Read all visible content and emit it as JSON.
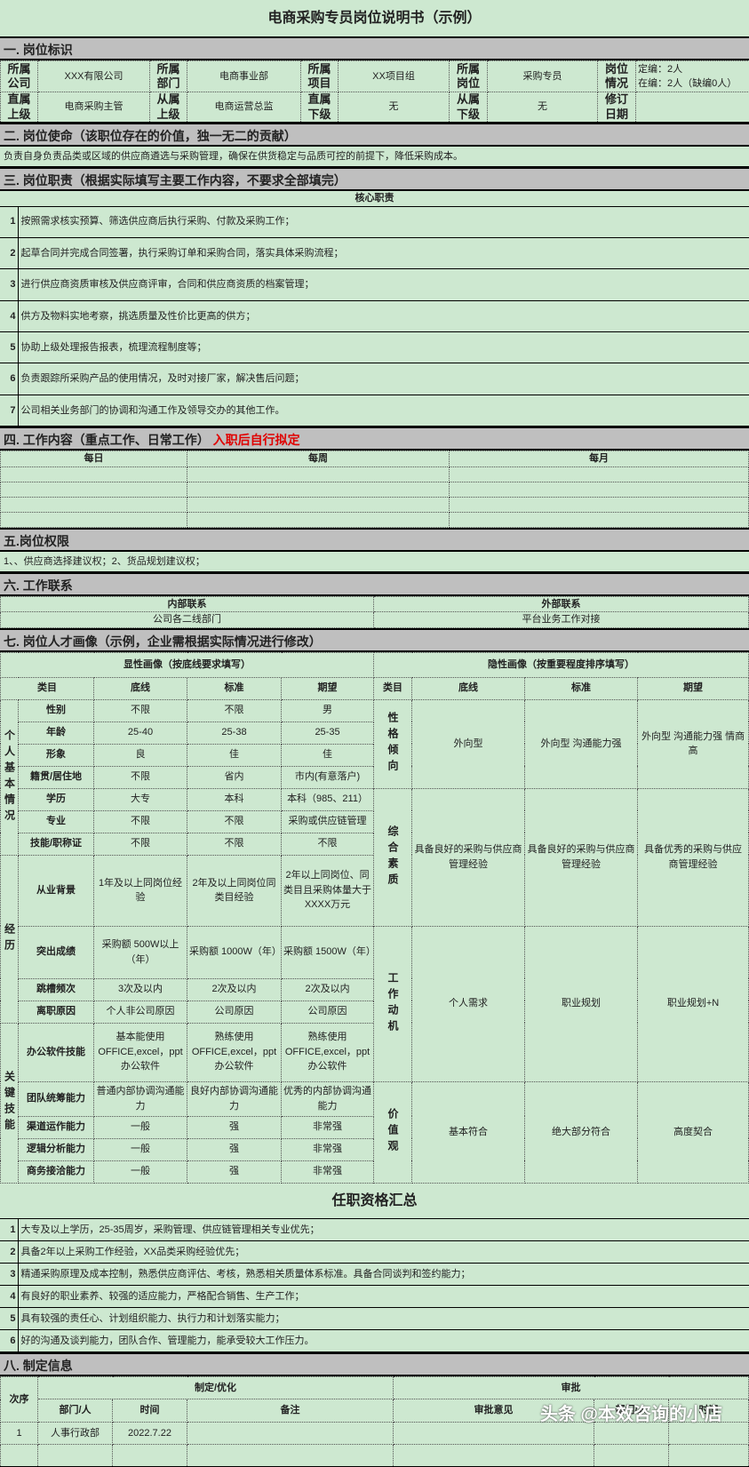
{
  "title": "电商采购专员岗位说明书（示例）",
  "s1": {
    "header": "一. 岗位标识",
    "row1": [
      {
        "label": "所属公司",
        "value": "XXX有限公司"
      },
      {
        "label": "所属部门",
        "value": "电商事业部"
      },
      {
        "label": "所属项目",
        "value": "XX项目组"
      },
      {
        "label": "所属岗位",
        "value": "采购专员"
      },
      {
        "label": "岗位情况",
        "value1": "定编：2人",
        "value2": "在编：2人（缺编0人）"
      }
    ],
    "row2": [
      {
        "label": "直属上级",
        "value": "电商采购主管"
      },
      {
        "label": "从属上级",
        "value": "电商运营总监"
      },
      {
        "label": "直属下级",
        "value": "无"
      },
      {
        "label": "从属下级",
        "value": "无"
      },
      {
        "label": "修订日期",
        "value": ""
      }
    ]
  },
  "s2": {
    "header": "二. 岗位使命（该职位存在的价值，独一无二的贡献）",
    "text": "负责自身负责品类或区域的供应商遴选与采购管理，确保在供货稳定与品质可控的前提下，降低采购成本。"
  },
  "s3": {
    "header": "三. 岗位职责（根据实际填写主要工作内容，不要求全部填完）",
    "subheader": "核心职责",
    "items": [
      {
        "n": "1",
        "t": "按照需求核实预算、筛选供应商后执行采购、付款及采购工作；"
      },
      {
        "n": "2",
        "t": "起草合同并完成合同签署，执行采购订单和采购合同，落实具体采购流程；"
      },
      {
        "n": "3",
        "t": "进行供应商资质审核及供应商评审，合同和供应商资质的档案管理；"
      },
      {
        "n": "4",
        "t": "供方及物料实地考察，挑选质量及性价比更高的供方；"
      },
      {
        "n": "5",
        "t": "协助上级处理报告报表，梳理流程制度等；"
      },
      {
        "n": "6",
        "t": "负责跟踪所采购产品的使用情况，及时对接厂家，解决售后问题；"
      },
      {
        "n": "7",
        "t": "公司相关业务部门的协调和沟通工作及领导交办的其他工作。"
      }
    ]
  },
  "s4": {
    "header": "四. 工作内容（重点工作、日常工作）",
    "note": "入职后自行拟定",
    "cols": [
      "每日",
      "每周",
      "每月"
    ]
  },
  "s5": {
    "header": "五.岗位权限",
    "text": "1、、供应商选择建议权；2、货品规划建议权；"
  },
  "s6": {
    "header": "六. 工作联系",
    "internal_label": "内部联系",
    "external_label": "外部联系",
    "internal": "公司各二线部门",
    "external": "平台业务工作对接"
  },
  "s7": {
    "header": "七. 岗位人才画像（示例，企业需根据实际情况进行修改）",
    "explicit_title": "显性画像（按底线要求填写）",
    "implicit_title": "隐性画像（按重要程度排序填写）",
    "cols": [
      "类目",
      "底线",
      "标准",
      "期望"
    ],
    "groups": [
      "个人基本情况",
      "经历",
      "关键技能"
    ],
    "rows": [
      {
        "k": "性别",
        "a": "不限",
        "b": "不限",
        "c": "男"
      },
      {
        "k": "年龄",
        "a": "25-40",
        "b": "25-38",
        "c": "25-35"
      },
      {
        "k": "形象",
        "a": "良",
        "b": "佳",
        "c": "佳"
      },
      {
        "k": "籍贯/居住地",
        "a": "不限",
        "b": "省内",
        "c": "市内(有意落户)"
      },
      {
        "k": "学历",
        "a": "大专",
        "b": "本科",
        "c": "本科（985、211）"
      },
      {
        "k": "专业",
        "a": "不限",
        "b": "不限",
        "c": "采购或供应链管理"
      },
      {
        "k": "技能/职称证",
        "a": "不限",
        "b": "不限",
        "c": "不限"
      },
      {
        "k": "从业背景",
        "a": "1年及以上同岗位经验",
        "b": "2年及以上同岗位同类目经验",
        "c": "2年以上同岗位、同类目且采购体量大于XXXX万元"
      },
      {
        "k": "突出成绩",
        "a": "采购额 500W以上（年）",
        "b": "采购额 1000W（年）",
        "c": "采购额 1500W（年）"
      },
      {
        "k": "跳槽频次",
        "a": "3次及以内",
        "b": "2次及以内",
        "c": "2次及以内"
      },
      {
        "k": "离职原因",
        "a": "个人非公司原因",
        "b": "公司原因",
        "c": "公司原因"
      },
      {
        "k": "办公软件技能",
        "a": "基本能使用OFFICE,excel，ppt办公软件",
        "b": "熟练使用OFFICE,excel，ppt办公软件",
        "c": "熟练使用OFFICE,excel，ppt办公软件"
      },
      {
        "k": "团队统筹能力",
        "a": "普通内部协调沟通能力",
        "b": "良好内部协调沟通能力",
        "c": "优秀的内部协调沟通能力"
      },
      {
        "k": "渠道运作能力",
        "a": "一般",
        "b": "强",
        "c": "非常强"
      },
      {
        "k": "逻辑分析能力",
        "a": "一般",
        "b": "强",
        "c": "非常强"
      },
      {
        "k": "商务接洽能力",
        "a": "一般",
        "b": "强",
        "c": "非常强"
      }
    ],
    "implicit": [
      {
        "k": "性格倾向",
        "a": "外向型",
        "b": "外向型 沟通能力强",
        "c": "外向型 沟通能力强 情商高"
      },
      {
        "k": "综合素质",
        "a": "具备良好的采购与供应商管理经验",
        "b": "具备良好的采购与供应商管理经验",
        "c": "具备优秀的采购与供应商管理经验"
      },
      {
        "k": "工作动机",
        "a": "个人需求",
        "b": "职业规划",
        "c": "职业规划+N"
      },
      {
        "k": "价值观",
        "a": "基本符合",
        "b": "绝大部分符合",
        "c": "高度契合"
      }
    ]
  },
  "summary": {
    "title": "任职资格汇总",
    "items": [
      {
        "n": "1",
        "t": "大专及以上学历，25-35周岁，采购管理、供应链管理相关专业优先；"
      },
      {
        "n": "2",
        "t": "具备2年以上采购工作经验，XX品类采购经验优先；"
      },
      {
        "n": "3",
        "t": "精通采购原理及成本控制，熟悉供应商评估、考核，熟悉相关质量体系标准。具备合同谈判和签约能力；"
      },
      {
        "n": "4",
        "t": "有良好的职业素养、较强的适应能力，严格配合销售、生产工作；"
      },
      {
        "n": "5",
        "t": "具有较强的责任心、计划组织能力、执行力和计划落实能力；"
      },
      {
        "n": "6",
        "t": "好的沟通及谈判能力，团队合作、管理能力，能承受较大工作压力。"
      }
    ]
  },
  "s8": {
    "header": "八. 制定信息",
    "seq": "次序",
    "make": "制定/优化",
    "approve": "审批",
    "cols": [
      "部门/人",
      "时间",
      "备注",
      "审批意见",
      "部门/人",
      "时间"
    ],
    "rows": [
      {
        "seq": "1",
        "dept": "人事行政部",
        "time": "2022.7.22"
      }
    ]
  },
  "watermark": "头条 @本效咨询的小店",
  "colors": {
    "background": "#cde8d0",
    "section": "#bfbfbf",
    "accent": "#e00000"
  }
}
